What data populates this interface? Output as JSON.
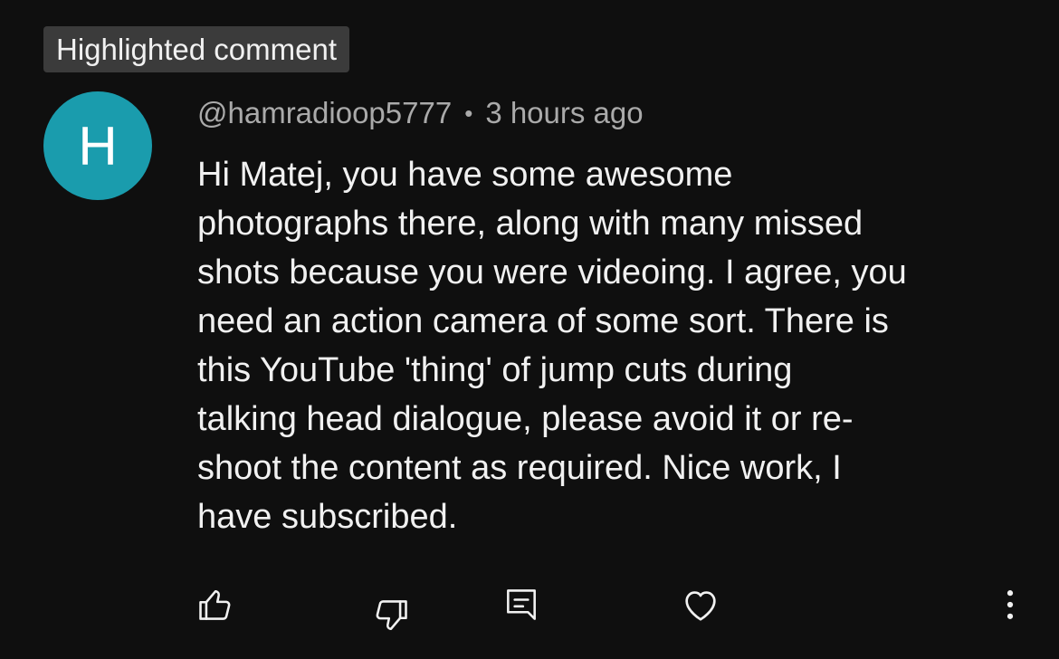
{
  "badge": {
    "label": "Highlighted comment"
  },
  "comment": {
    "avatar_letter": "H",
    "avatar_color": "#1a9cad",
    "author": "@hamradioop5777",
    "separator": "•",
    "time": "3 hours ago",
    "lines": [
      "Hi Matej, you have some awesome",
      "photographs there, along with many missed",
      "shots because you were videoing. I agree, you",
      "need an action camera of some sort. There is",
      "this YouTube 'thing' of jump cuts during",
      "talking head dialogue, please avoid it or re-",
      "shoot the content as required. Nice work, I",
      "have subscribed."
    ]
  },
  "actions": {
    "like": {
      "icon": "thumbs-up-icon"
    },
    "dislike": {
      "icon": "thumbs-down-icon"
    },
    "reply": {
      "icon": "reply-icon"
    },
    "heart": {
      "icon": "heart-icon"
    },
    "more": {
      "icon": "more-vertical-icon"
    }
  }
}
